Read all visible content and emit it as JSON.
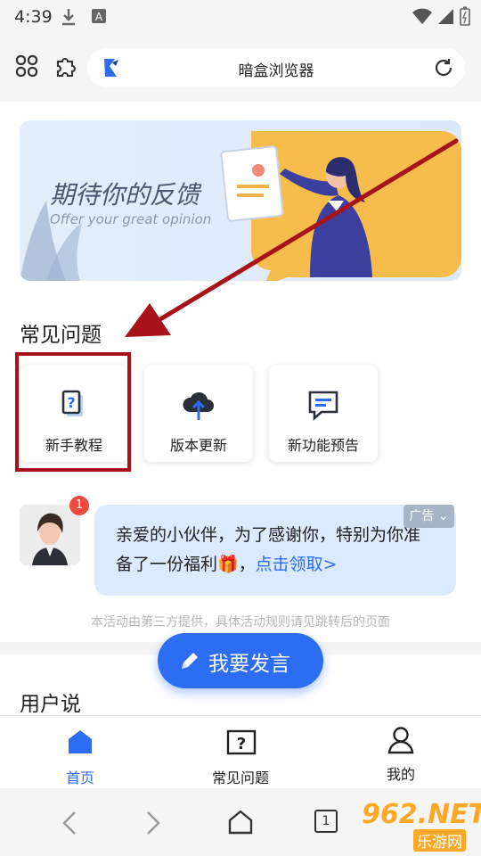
{
  "status_bar": {
    "time": "4:39"
  },
  "browser": {
    "title": "暗盒浏览器"
  },
  "banner": {
    "title": "期待你的反馈",
    "subtitle": "Offer your great opinion"
  },
  "faq": {
    "title": "常见问题",
    "cards": [
      {
        "label": "新手教程"
      },
      {
        "label": "版本更新"
      },
      {
        "label": "新功能预告"
      }
    ]
  },
  "promo": {
    "badge_count": "1",
    "text": "亲爱的小伙伴，为了感谢你，特别为你准备了一份福利🎁，",
    "link": "点击领取>",
    "ad_label": "广告",
    "disclaimer": "本活动由第三方提供，具体活动规则请见跳转后的页面"
  },
  "users_say": {
    "title": "用户说"
  },
  "fab": {
    "label": "我要发言"
  },
  "bottom_nav": {
    "items": [
      {
        "label": "首页",
        "active": true
      },
      {
        "label": "常见问题",
        "active": false
      },
      {
        "label": "我的",
        "active": false
      }
    ]
  },
  "system_nav": {
    "tab_count": "1"
  },
  "watermark": {
    "text": "962.NET",
    "subtext": "乐游网"
  },
  "colors": {
    "accent": "#2c6df4",
    "highlight_box": "#a8121a",
    "bubble": "#dbeaff"
  }
}
